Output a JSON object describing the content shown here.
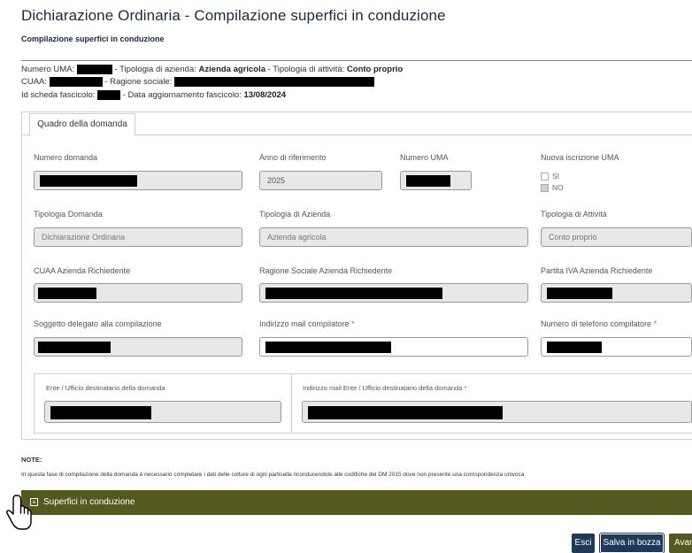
{
  "page": {
    "title": "Dichiarazione Ordinaria - Compilazione superfici in conduzione",
    "subtitle": "Compilazione superfici in conduzione"
  },
  "info": {
    "line1_numero_uma": "Numero UMA:",
    "line1_tipologia_azienda_label": "- Tipologia di azienda:",
    "line1_tipologia_azienda_value": "Azienda agricola",
    "line1_tipologia_attivita_label": "- Tipologia di attività:",
    "line1_tipologia_attivita_value": "Conto proprio",
    "line2_cuaa": "CUAA:",
    "line2_ragione_sociale": "- Ragione sociale:",
    "line3_id_scheda": "Id scheda fascicolo:",
    "line3_data_label": "- Data aggiornamento fascicolo:",
    "line3_data_value": "13/08/2024"
  },
  "tab": {
    "label": "Quadro della domanda"
  },
  "form": {
    "numero_domanda_label": "Numero domanda",
    "anno_label": "Anno di riferimento",
    "anno_value": "2025",
    "numero_uma_label": "Numero UMA",
    "nuova_iscrizione_label": "Nuova iscrizione UMA",
    "opt_si": "SI",
    "opt_no": "NO",
    "tipologia_domanda_label": "Tipologia Domanda",
    "tipologia_domanda_value": "Dichiarazione Ordinaria",
    "tipologia_azienda_label": "Tipologia di Azienda",
    "tipologia_azienda_value": "Azienda agricola",
    "tipologia_attivita_label": "Tipologia di Attività",
    "tipologia_attivita_value": "Conto proprio",
    "cuaa_label": "CUAA Azienda Richiedente",
    "ragione_sociale_label": "Ragione Sociale Azienda Richiedente",
    "partita_iva_label": "Partita IVA Azienda Richiedente",
    "soggetto_label": "Soggetto delegato alla compilazione",
    "mail_compilatore_label": "Indirizzo mail compilatore",
    "telefono_label": "Numero di telefono compilatore",
    "required_mark": "*",
    "ente_label": "Ente / Ufficio destinatario della domanda",
    "mail_ente_label": "Indirizzo mail Ente / Ufficio destinatario della domanda"
  },
  "notes": {
    "heading": "NOTE:",
    "text": "In questa fase di compilazione della domanda è necessario completare i dati delle colture di ogni particella riconducendole alle codifiche del DM 2015 dove non presente una corrispondenza univoca"
  },
  "accordion": {
    "icon": "plus-square-icon",
    "label": "Superfici in conduzione"
  },
  "buttons": {
    "esci": "Esci",
    "salva": "Salva in bozza",
    "avanti": "Avanti"
  },
  "colors": {
    "accent_olive": "#55581f",
    "button_navy": "#1f3a57"
  }
}
